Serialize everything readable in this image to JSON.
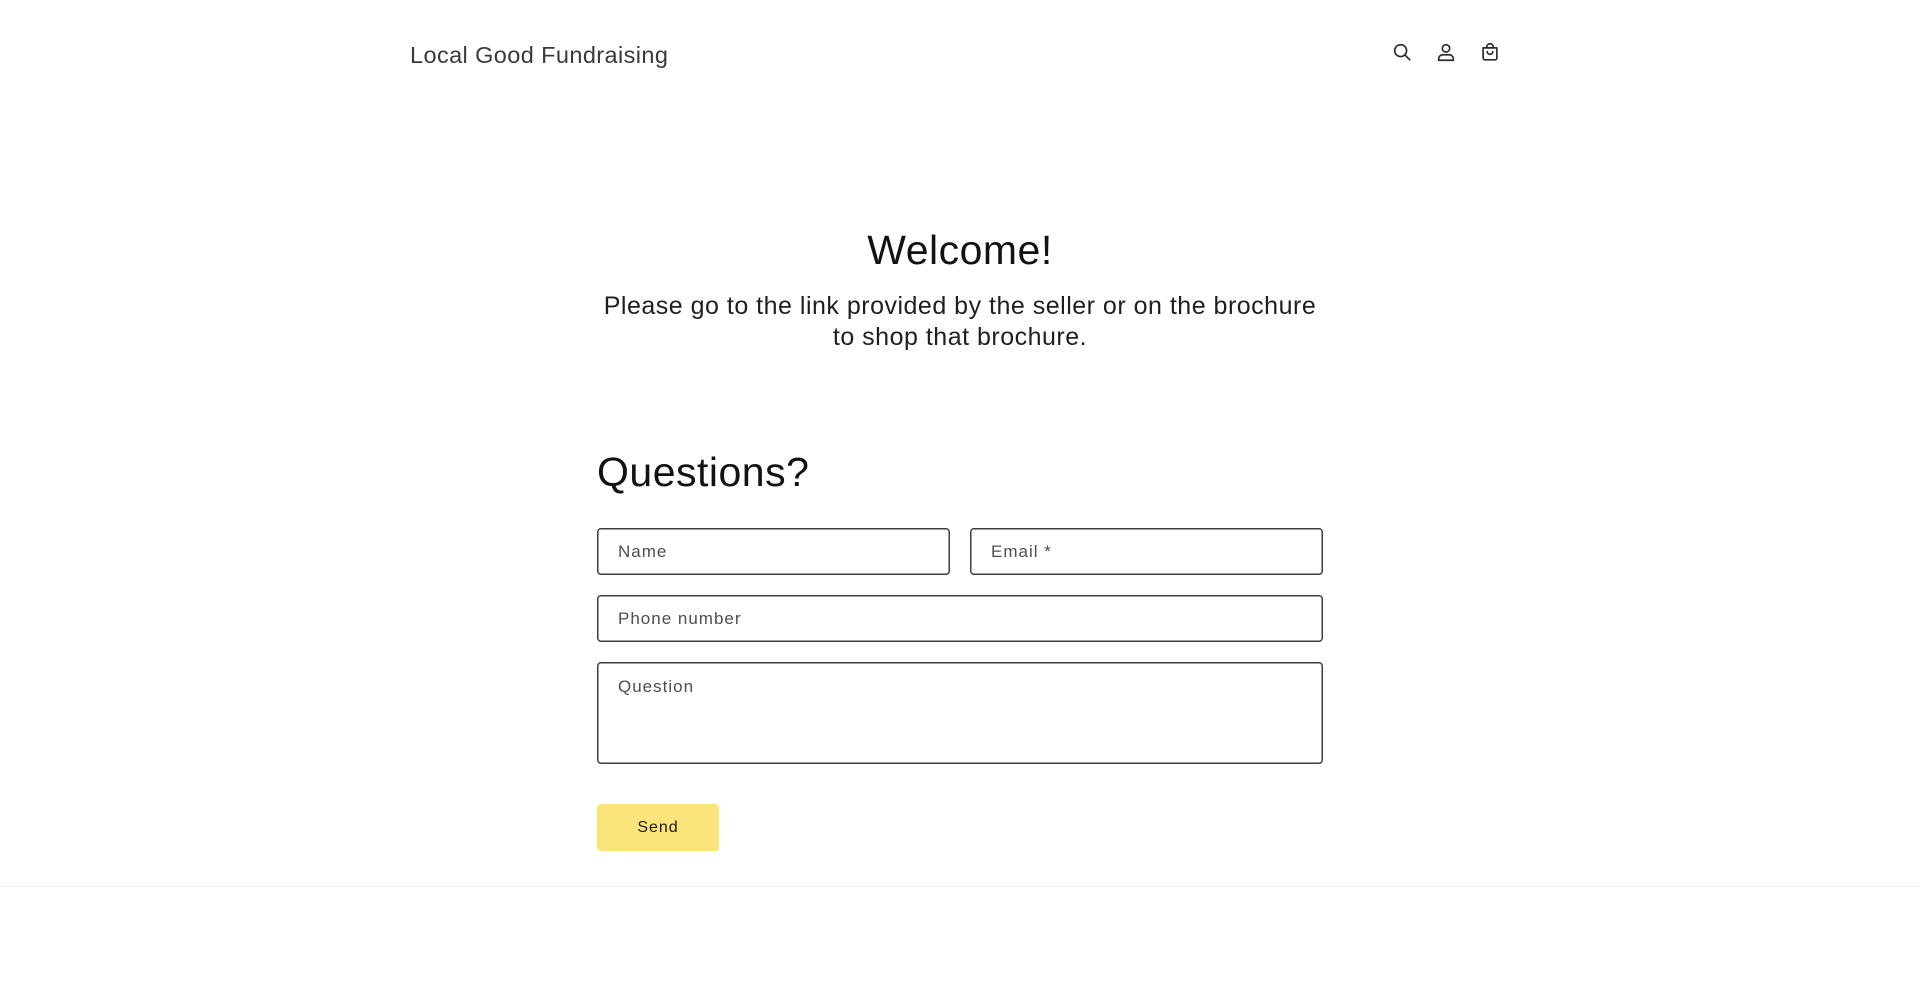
{
  "header": {
    "brand": "Local Good Fundraising",
    "icons": [
      "search-icon",
      "account-icon",
      "cart-icon"
    ]
  },
  "welcome": {
    "title": "Welcome!",
    "text": "Please go to the link provided by the seller or on the brochure to shop that brochure."
  },
  "contact": {
    "title": "Questions?",
    "name_placeholder": "Name",
    "email_placeholder": "Email *",
    "phone_placeholder": "Phone number",
    "question_placeholder": "Question",
    "send_label": "Send"
  },
  "colors": {
    "button_bg": "#fbe47a",
    "text": "#121212",
    "border": "#3d3d3d",
    "divider": "#ececec"
  }
}
